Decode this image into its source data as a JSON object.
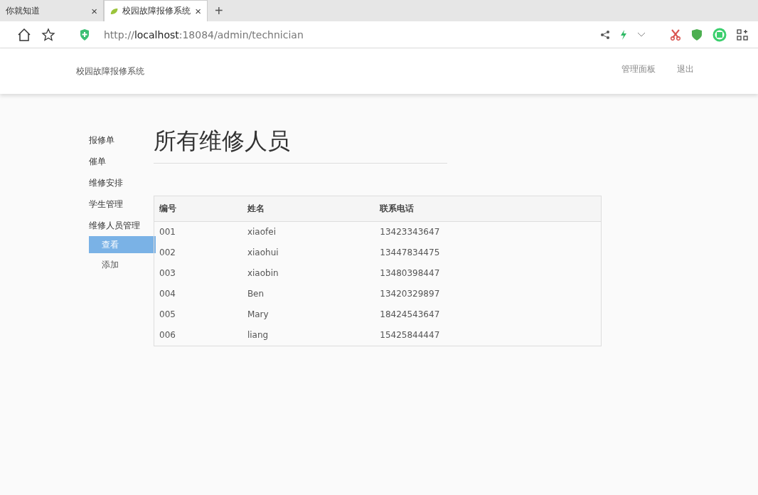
{
  "browser": {
    "tabs": [
      {
        "title": "你就知道",
        "selected": false,
        "close": "×"
      },
      {
        "title": "校园故障报修系统",
        "selected": true,
        "close": "×"
      }
    ],
    "new_tab": "+",
    "url": {
      "protocol": "http://",
      "host": "localhost",
      "rest": ":18084/admin/technician"
    }
  },
  "navbar": {
    "brand": "校园故障报修系统",
    "links": [
      "管理面板",
      "退出"
    ]
  },
  "sidebar": {
    "items": [
      {
        "label": "报修单"
      },
      {
        "label": "催单"
      },
      {
        "label": "维修安排"
      },
      {
        "label": "学生管理"
      },
      {
        "label": "维修人员管理",
        "children": [
          {
            "label": "查看",
            "selected": true
          },
          {
            "label": "添加",
            "selected": false
          }
        ]
      }
    ]
  },
  "page_title": "所有维修人员",
  "table": {
    "columns": [
      "编号",
      "姓名",
      "联系电话"
    ],
    "rows": [
      [
        "001",
        "xiaofei",
        "13423343647"
      ],
      [
        "002",
        "xiaohui",
        "13447834475"
      ],
      [
        "003",
        "xiaobin",
        "13480398447"
      ],
      [
        "004",
        "Ben",
        "13420329897"
      ],
      [
        "005",
        "Mary",
        "18424543647"
      ],
      [
        "006",
        "liang",
        "15425844447"
      ]
    ]
  }
}
